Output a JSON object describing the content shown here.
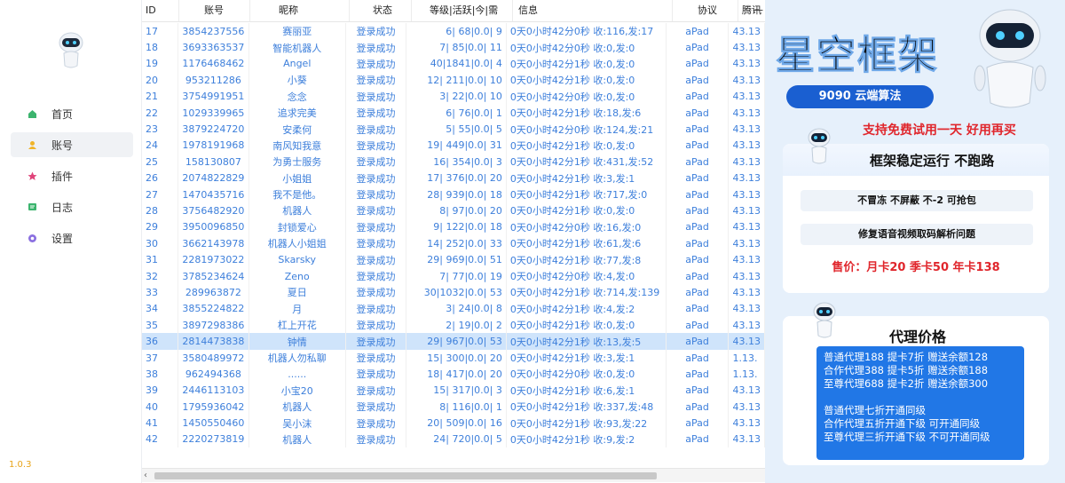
{
  "sidebar": {
    "version": "1.0.3",
    "items": [
      {
        "label": "首页"
      },
      {
        "label": "账号"
      },
      {
        "label": "插件"
      },
      {
        "label": "日志"
      },
      {
        "label": "设置"
      }
    ]
  },
  "window": {
    "minimize": "—"
  },
  "table": {
    "columns": [
      "ID",
      "账号",
      "昵称",
      "状态",
      "等级|活跃|今|需",
      "信息",
      "协议",
      "腾讯"
    ],
    "rows": [
      [
        "17",
        "3854237556",
        "赛丽亚",
        "登录成功",
        "6| 68|0.0| 9",
        "0天0小时42分0秒 收:116,发:17",
        "aPad",
        "43.13"
      ],
      [
        "18",
        "3693363537",
        "智能机器人",
        "登录成功",
        "7| 85|0.0| 11",
        "0天0小时42分0秒 收:0,发:0",
        "aPad",
        "43.13"
      ],
      [
        "19",
        "1176468462",
        "Angel",
        "登录成功",
        "40|1841|0.0| 4",
        "0天0小时42分1秒 收:0,发:0",
        "aPad",
        "43.13"
      ],
      [
        "20",
        "953211286",
        "小葵",
        "登录成功",
        "12| 211|0.0| 10",
        "0天0小时42分1秒 收:0,发:0",
        "aPad",
        "43.13"
      ],
      [
        "21",
        "3754991951",
        "念念",
        "登录成功",
        "3| 22|0.0| 10",
        "0天0小时42分0秒 收:0,发:0",
        "aPad",
        "43.13"
      ],
      [
        "22",
        "1029339965",
        "追求完美",
        "登录成功",
        "6| 76|0.0| 1",
        "0天0小时42分1秒 收:18,发:6",
        "aPad",
        "43.13"
      ],
      [
        "23",
        "3879224720",
        "安柔何",
        "登录成功",
        "5| 55|0.0| 5",
        "0天0小时42分0秒 收:124,发:21",
        "aPad",
        "43.13"
      ],
      [
        "24",
        "1978191968",
        "南风知我意",
        "登录成功",
        "19| 449|0.0| 31",
        "0天0小时42分1秒 收:0,发:0",
        "aPad",
        "43.13"
      ],
      [
        "25",
        "158130807",
        "为勇士服务",
        "登录成功",
        "16| 354|0.0| 3",
        "0天0小时42分1秒 收:431,发:52",
        "aPad",
        "43.13"
      ],
      [
        "26",
        "2074822829",
        "小姐姐",
        "登录成功",
        "17| 376|0.0| 20",
        "0天0小时42分1秒 收:3,发:1",
        "aPad",
        "43.13"
      ],
      [
        "27",
        "1470435716",
        "我不是他。",
        "登录成功",
        "28| 939|0.0| 18",
        "0天0小时42分1秒 收:717,发:0",
        "aPad",
        "43.13"
      ],
      [
        "28",
        "3756482920",
        "机器人",
        "登录成功",
        "8| 97|0.0| 20",
        "0天0小时42分1秒 收:0,发:0",
        "aPad",
        "43.13"
      ],
      [
        "29",
        "3950096850",
        "封锁爱心",
        "登录成功",
        "9| 122|0.0| 18",
        "0天0小时42分0秒 收:16,发:0",
        "aPad",
        "43.13"
      ],
      [
        "30",
        "3662143978",
        "机器人小姐姐",
        "登录成功",
        "14| 252|0.0| 33",
        "0天0小时42分1秒 收:61,发:6",
        "aPad",
        "43.13"
      ],
      [
        "31",
        "2281973022",
        "Skarsky",
        "登录成功",
        "29| 969|0.0| 51",
        "0天0小时42分1秒 收:77,发:8",
        "aPad",
        "43.13"
      ],
      [
        "32",
        "3785234624",
        "Zeno",
        "登录成功",
        "7| 77|0.0| 19",
        "0天0小时42分0秒 收:4,发:0",
        "aPad",
        "43.13"
      ],
      [
        "33",
        "289963872",
        "夏日",
        "登录成功",
        "30|1032|0.0| 53",
        "0天0小时42分1秒 收:714,发:139",
        "aPad",
        "43.13"
      ],
      [
        "34",
        "3855224822",
        "月",
        "登录成功",
        "3| 24|0.0| 8",
        "0天0小时42分1秒 收:4,发:2",
        "aPad",
        "43.13"
      ],
      [
        "35",
        "3897298386",
        "杠上开花",
        "登录成功",
        "2| 19|0.0| 2",
        "0天0小时42分1秒 收:0,发:0",
        "aPad",
        "43.13"
      ],
      [
        "36",
        "2814473838",
        "钟情",
        "登录成功",
        "29| 967|0.0| 53",
        "0天0小时42分1秒 收:13,发:5",
        "aPad",
        "43.13"
      ],
      [
        "37",
        "3580489972",
        "机器人勿私聊",
        "登录成功",
        "15| 300|0.0| 20",
        "0天0小时42分1秒 收:3,发:1",
        "aPad",
        "1.13."
      ],
      [
        "38",
        "962494368",
        "......",
        "登录成功",
        "18| 417|0.0| 20",
        "0天0小时42分0秒 收:0,发:0",
        "aPad",
        "1.13."
      ],
      [
        "39",
        "2446113103",
        "小宝20",
        "登录成功",
        "15| 317|0.0| 3",
        "0天0小时42分1秒 收:6,发:1",
        "aPad",
        "43.13"
      ],
      [
        "40",
        "1795936042",
        "机器人",
        "登录成功",
        "8| 116|0.0| 1",
        "0天0小时42分1秒 收:337,发:48",
        "aPad",
        "43.13"
      ],
      [
        "41",
        "1450550460",
        "吴小沫",
        "登录成功",
        "20| 509|0.0| 16",
        "0天0小时42分1秒 收:93,发:22",
        "aPad",
        "43.13"
      ],
      [
        "42",
        "2220273819",
        "机器人",
        "登录成功",
        "24| 720|0.0| 5",
        "0天0小时42分1秒 收:9,发:2",
        "aPad",
        "43.13"
      ]
    ],
    "selected_row": 19
  },
  "ad": {
    "title": "星空框架",
    "algo": "9090 云端算法",
    "trial": "支持免费试用一天 好用再买",
    "card1": {
      "title": "框架稳定运行 不跑路",
      "row1": "不冒冻 不屏蔽 不-2 可抢包",
      "row2": "修复语音视频取码解析问题",
      "price": "售价：月卡20 季卡50 年卡138"
    },
    "card2": {
      "title": "代理价格",
      "lines": [
        "普通代理188 提卡7折 赠送余额128",
        "合作代理388 提卡5折 赠送余额188",
        "至尊代理688 提卡2折 赠送余额300",
        "",
        "普通代理七折开通同级",
        "合作代理五折开通下级 可开通同级",
        "至尊代理三折开通下级 不可开通同级"
      ]
    }
  },
  "colors": {
    "accent": "#3d7fdb",
    "selected_row": "#cfe4fb",
    "price_red": "#e0262c",
    "ad_blue": "#2177e6"
  }
}
